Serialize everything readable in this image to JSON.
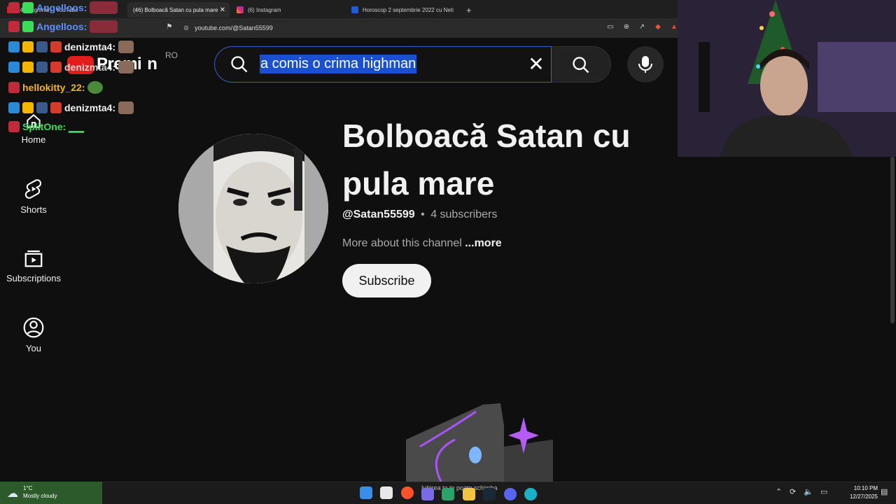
{
  "browser": {
    "tabs": [
      {
        "title": "(46) highman - YouTube",
        "active": false
      },
      {
        "title": "(46) Bolboacă Satan cu pula mare",
        "active": true
      },
      {
        "title": "(6) Instagram",
        "active": false
      },
      {
        "title": "Horoscop 2 septembrie 2022 cu Neti",
        "active": false
      }
    ],
    "url": "youtube.com/@Satan55599"
  },
  "youtube": {
    "logo_text": "Premi",
    "logo_suffix": "n",
    "country_code": "RO",
    "search_query": "a comis o crima highman",
    "nav": [
      {
        "label": "Home",
        "icon": "home-icon"
      },
      {
        "label": "Shorts",
        "icon": "shorts-icon"
      },
      {
        "label": "Subscriptions",
        "icon": "subscriptions-icon"
      },
      {
        "label": "You",
        "icon": "you-icon"
      }
    ],
    "channel": {
      "title": "Bolboacă Satan cu pula mare",
      "handle": "@Satan55599",
      "separator": "•",
      "subscribers": "4 subscribers",
      "about": "More about this channel",
      "more_label": "...more",
      "subscribe_label": "Subscribe"
    }
  },
  "chat": [
    {
      "user": "Angelloos:",
      "color": "#5b8fff"
    },
    {
      "user": "Angelloos:",
      "color": "#5b8fff"
    },
    {
      "user": "denizmta4:",
      "color": "#f1f1f1"
    },
    {
      "user": "denizmta4:",
      "color": "#f1f1f1"
    },
    {
      "user": "hellokitty_22:",
      "color": "#f0b429"
    },
    {
      "user": "denizmta4:",
      "color": "#f1f1f1"
    },
    {
      "user": "SplitOne:",
      "color": "#3cdc5a"
    }
  ],
  "taskbar": {
    "temperature": "1°C",
    "weather": "Mostly cloudy",
    "media_text": "Iubirea ta te poate schimba",
    "time": "10:10 PM",
    "date": "12/27/2025"
  },
  "colors": {
    "background": "#0f0f0f",
    "search_highlight": "#1a4fcf",
    "accent_red": "#e01e1e"
  }
}
